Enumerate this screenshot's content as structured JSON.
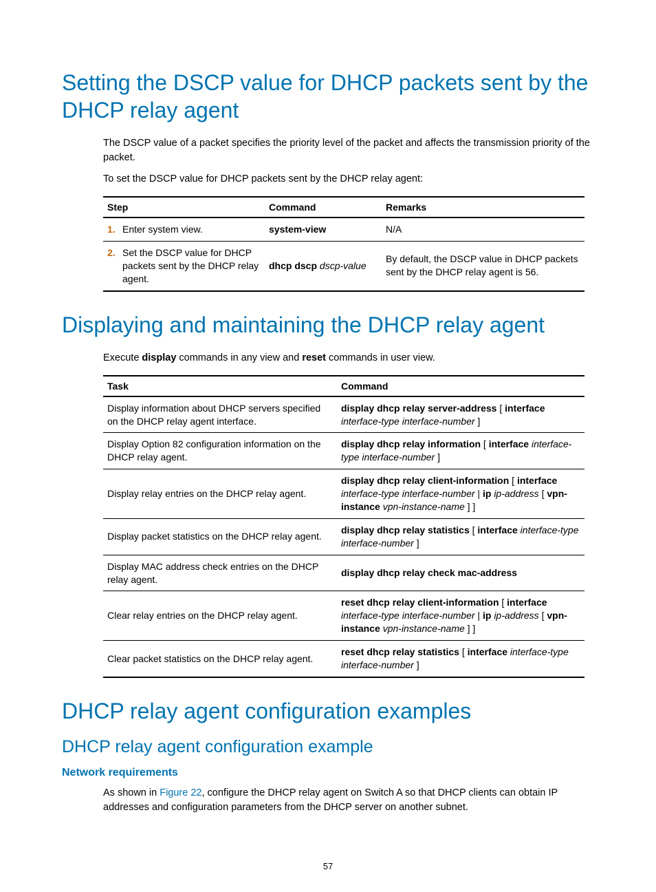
{
  "section1": {
    "title": "Setting the DSCP value for DHCP packets sent by the DHCP relay agent",
    "para1": "The DSCP value of a packet specifies the priority level of the packet and affects the transmission priority of the packet.",
    "para2": "To set the DSCP value for DHCP packets sent by the DHCP relay agent:",
    "table": {
      "headers": {
        "c1": "Step",
        "c2": "Command",
        "c3": "Remarks"
      },
      "rows": [
        {
          "num": "1.",
          "step": "Enter system view.",
          "cmd_bold": "system-view",
          "cmd_it": "",
          "remarks": "N/A"
        },
        {
          "num": "2.",
          "step": "Set the DSCP value for DHCP packets sent by the DHCP relay agent.",
          "cmd_bold": "dhcp dscp",
          "cmd_it": "dscp-value",
          "remarks": "By default, the DSCP value in DHCP packets sent by the DHCP relay agent is 56."
        }
      ]
    }
  },
  "section2": {
    "title": "Displaying and maintaining the DHCP relay agent",
    "para_pre": "Execute ",
    "para_b1": "display",
    "para_mid": " commands in any view and ",
    "para_b2": "reset",
    "para_post": " commands in user view.",
    "table": {
      "headers": {
        "c1": "Task",
        "c2": "Command"
      },
      "rows": [
        {
          "task": "Display information about DHCP servers specified on the DHCP relay agent interface.",
          "cmd": [
            {
              "t": "b",
              "v": "display dhcp relay server-address"
            },
            {
              "t": "p",
              "v": " [ "
            },
            {
              "t": "b",
              "v": "interface"
            },
            {
              "t": "p",
              "v": " "
            },
            {
              "t": "i",
              "v": "interface-type interface-number"
            },
            {
              "t": "p",
              "v": " ]"
            }
          ]
        },
        {
          "task": "Display Option 82 configuration information on the DHCP relay agent.",
          "cmd": [
            {
              "t": "b",
              "v": "display dhcp relay information"
            },
            {
              "t": "p",
              "v": " [ "
            },
            {
              "t": "b",
              "v": "interface"
            },
            {
              "t": "p",
              "v": " "
            },
            {
              "t": "i",
              "v": "interface-type interface-number"
            },
            {
              "t": "p",
              "v": " ]"
            }
          ]
        },
        {
          "task": "Display relay entries on the DHCP relay agent.",
          "cmd": [
            {
              "t": "b",
              "v": "display dhcp relay client-information"
            },
            {
              "t": "p",
              "v": " [ "
            },
            {
              "t": "b",
              "v": "interface"
            },
            {
              "t": "p",
              "v": " "
            },
            {
              "t": "i",
              "v": "interface-type interface-number"
            },
            {
              "t": "p",
              "v": " | "
            },
            {
              "t": "b",
              "v": "ip"
            },
            {
              "t": "p",
              "v": " "
            },
            {
              "t": "i",
              "v": "ip-address"
            },
            {
              "t": "p",
              "v": " [ "
            },
            {
              "t": "b",
              "v": "vpn-instance"
            },
            {
              "t": "p",
              "v": " "
            },
            {
              "t": "i",
              "v": "vpn-instance-name"
            },
            {
              "t": "p",
              "v": " ] ]"
            }
          ]
        },
        {
          "task": "Display packet statistics on the DHCP relay agent.",
          "cmd": [
            {
              "t": "b",
              "v": "display dhcp relay statistics"
            },
            {
              "t": "p",
              "v": " [ "
            },
            {
              "t": "b",
              "v": "interface"
            },
            {
              "t": "p",
              "v": " "
            },
            {
              "t": "i",
              "v": "interface-type interface-number"
            },
            {
              "t": "p",
              "v": " ]"
            }
          ]
        },
        {
          "task": "Display MAC address check entries on the DHCP relay agent.",
          "cmd": [
            {
              "t": "b",
              "v": "display dhcp relay check mac-address"
            }
          ]
        },
        {
          "task": "Clear relay entries on the DHCP relay agent.",
          "cmd": [
            {
              "t": "b",
              "v": "reset dhcp relay client-information"
            },
            {
              "t": "p",
              "v": " [ "
            },
            {
              "t": "b",
              "v": "interface"
            },
            {
              "t": "p",
              "v": " "
            },
            {
              "t": "i",
              "v": "interface-type interface-number"
            },
            {
              "t": "p",
              "v": " | "
            },
            {
              "t": "b",
              "v": "ip"
            },
            {
              "t": "p",
              "v": " "
            },
            {
              "t": "i",
              "v": "ip-address"
            },
            {
              "t": "p",
              "v": " [ "
            },
            {
              "t": "b",
              "v": "vpn-instance"
            },
            {
              "t": "p",
              "v": " "
            },
            {
              "t": "i",
              "v": "vpn-instance-name"
            },
            {
              "t": "p",
              "v": " ] ]"
            }
          ]
        },
        {
          "task": "Clear packet statistics on the DHCP relay agent.",
          "cmd": [
            {
              "t": "b",
              "v": "reset dhcp relay statistics"
            },
            {
              "t": "p",
              "v": " [ "
            },
            {
              "t": "b",
              "v": "interface"
            },
            {
              "t": "p",
              "v": " "
            },
            {
              "t": "i",
              "v": "interface-type interface-number"
            },
            {
              "t": "p",
              "v": " ]"
            }
          ]
        }
      ]
    }
  },
  "section3": {
    "title": "DHCP relay agent configuration examples",
    "sub": "DHCP relay agent configuration example",
    "subsub": "Network requirements",
    "para_pre": "As shown in ",
    "para_link": "Figure 22",
    "para_post": ", configure the DHCP relay agent on Switch A so that DHCP clients can obtain IP addresses and configuration parameters from the DHCP server on another subnet."
  },
  "page_number": "57"
}
